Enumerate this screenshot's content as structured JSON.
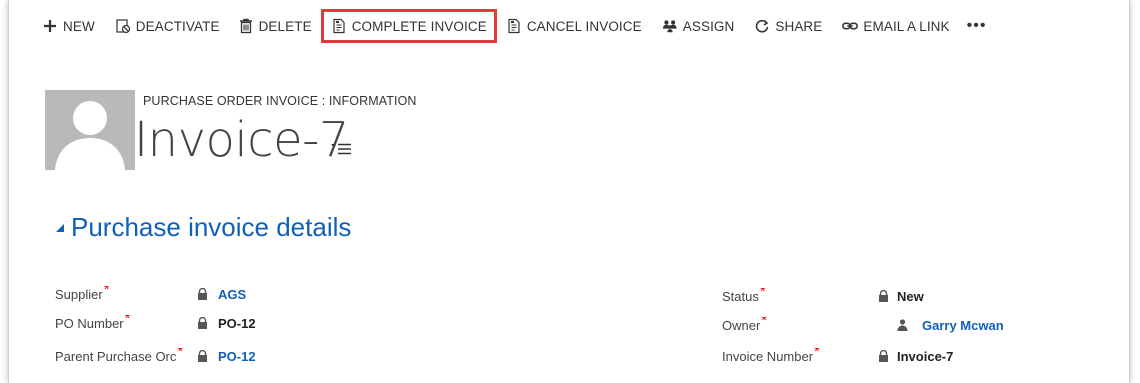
{
  "toolbar": {
    "new_label": "NEW",
    "deactivate_label": "DEACTIVATE",
    "delete_label": "DELETE",
    "complete_invoice_label": "COMPLETE INVOICE",
    "cancel_invoice_label": "CANCEL INVOICE",
    "assign_label": "ASSIGN",
    "share_label": "SHARE",
    "email_link_label": "EMAIL A LINK",
    "more_label": "•••",
    "highlight_color": "#e5383b"
  },
  "header": {
    "entity_label": "PURCHASE ORDER INVOICE : INFORMATION",
    "record_title": "Invoice-7"
  },
  "section": {
    "title": "Purchase invoice details",
    "title_color": "#1160b7"
  },
  "fields": {
    "left": [
      {
        "label": "Supplier",
        "value": "AGS",
        "link": true
      },
      {
        "label": "PO Number",
        "value": "PO-12",
        "link": false
      },
      {
        "label": "Parent Purchase Orc",
        "value": "PO-12",
        "link": true
      }
    ],
    "right": [
      {
        "label": "Status",
        "value": "New",
        "link": false
      },
      {
        "label": "Owner",
        "value": "Garry Mcwan",
        "link": true
      },
      {
        "label": "Invoice Number",
        "value": "Invoice-7",
        "link": false
      }
    ],
    "required_mark": "*"
  }
}
